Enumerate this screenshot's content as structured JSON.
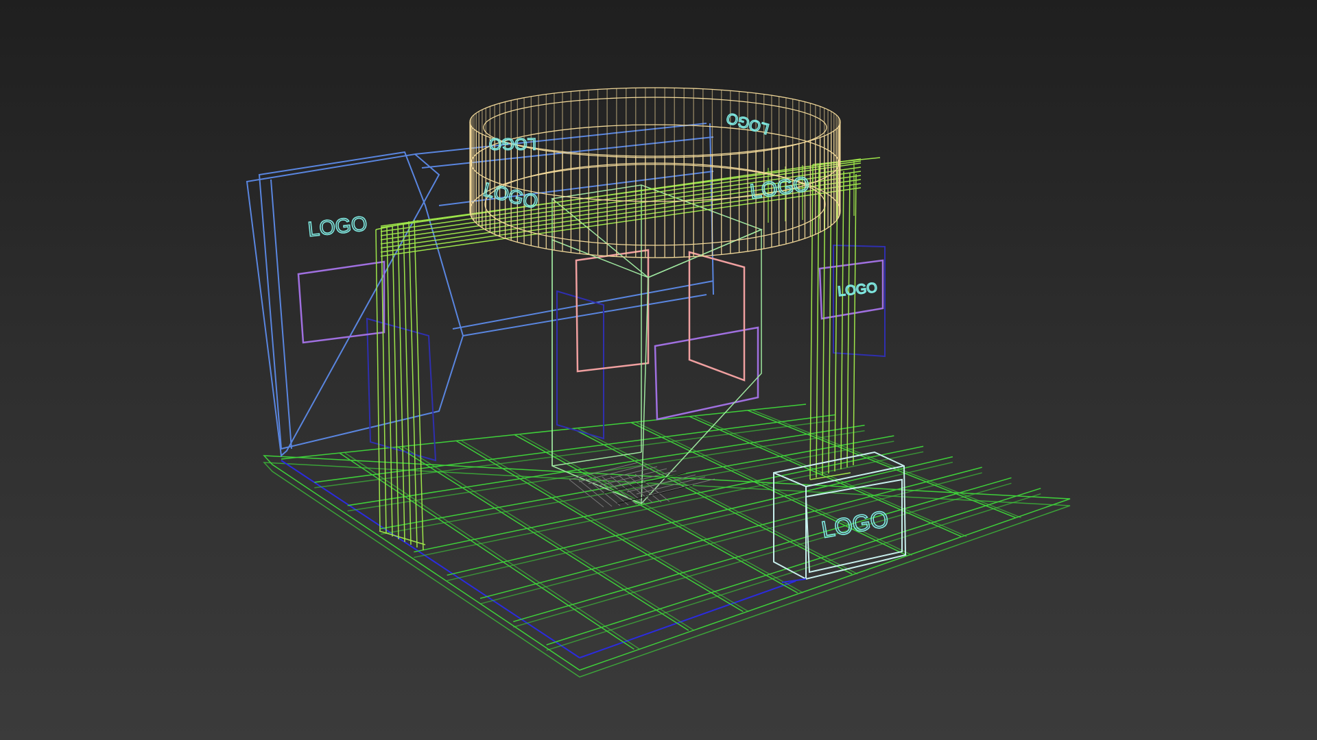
{
  "viewport": {
    "label": "wireframe-perspective-view",
    "background_top": "#1f1f1f",
    "background_bottom": "#3b3b3b"
  },
  "colors": {
    "floor": "#3fd13a",
    "floor_edge": "#2b2be0",
    "back_wall": "#5a86e0",
    "columns": "#9ee64a",
    "ring": "#f2d99a",
    "logo_text": "#7fe8e0",
    "frames_pink": "#f0a0a0",
    "frames_purple": "#a070e0",
    "frames_navy": "#2f2fb0",
    "center_box": "#9fe8a0",
    "counter": "#c8f0ee"
  },
  "labels": {
    "wall_logo": "LOGO",
    "ring_logo_front_left": "LOGO",
    "ring_logo_front_right": "LOGO",
    "ring_logo_back_left": "LOGO",
    "ring_logo_back_right": "LOGO",
    "column_logo": "LOGO",
    "counter_logo": "LOGO"
  }
}
